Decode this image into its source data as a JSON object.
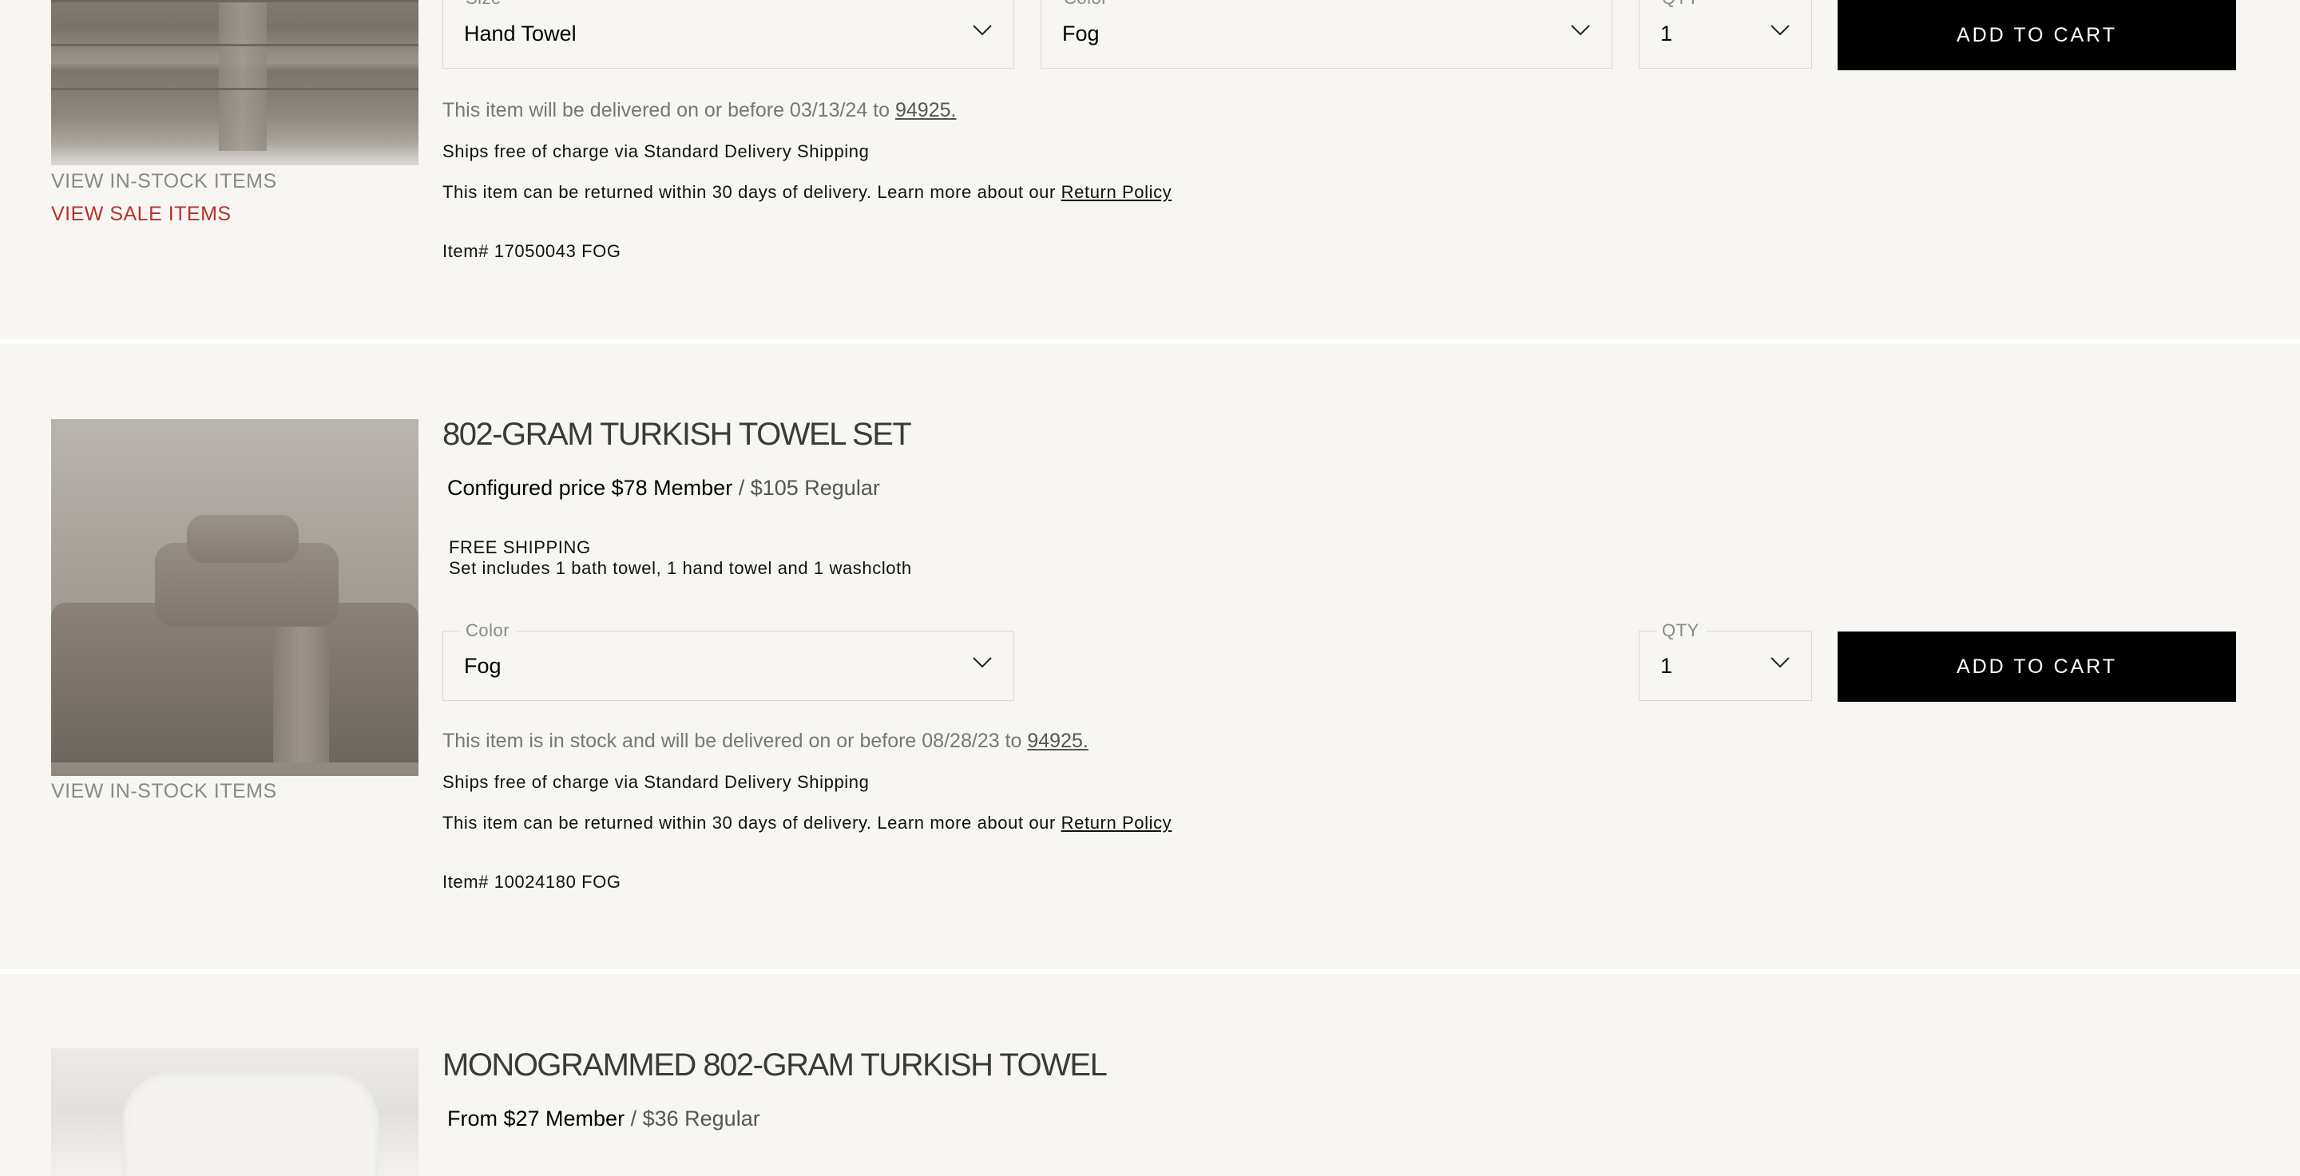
{
  "products": [
    {
      "fields": {
        "size": {
          "label": "Size",
          "value": "Hand Towel"
        },
        "color": {
          "label": "Color",
          "value": "Fog"
        },
        "qty": {
          "label": "QTY",
          "value": "1"
        }
      },
      "add_to_cart": "ADD TO CART",
      "delivery_text": "This item will be delivered on or before 03/13/24 to",
      "zip": "94925.",
      "shipping": "Ships free of charge via Standard Delivery Shipping",
      "returns_text": "This item can be returned within 30 days of delivery. Learn more about our",
      "return_policy": "Return Policy",
      "item_number": "Item# 17050043 FOG",
      "links": {
        "in_stock": "VIEW IN-STOCK ITEMS",
        "sale": "VIEW SALE ITEMS"
      }
    },
    {
      "title": "802-GRAM TURKISH TOWEL SET",
      "price_member": "Configured price $78 Member",
      "price_regular": "/ $105 Regular",
      "free_shipping": "FREE SHIPPING",
      "set_includes": "Set includes 1 bath towel, 1 hand towel and 1 washcloth",
      "fields": {
        "color": {
          "label": "Color",
          "value": "Fog"
        },
        "qty": {
          "label": "QTY",
          "value": "1"
        }
      },
      "add_to_cart": "ADD TO CART",
      "delivery_text": "This item is in stock and will be delivered on or before 08/28/23 to",
      "zip": "94925.",
      "shipping": "Ships free of charge via Standard Delivery Shipping",
      "returns_text": "This item can be returned within 30 days of delivery. Learn more about our",
      "return_policy": "Return Policy",
      "item_number": "Item# 10024180 FOG",
      "links": {
        "in_stock": "VIEW IN-STOCK ITEMS"
      }
    },
    {
      "title": "MONOGRAMMED 802-GRAM TURKISH TOWEL",
      "price_member": "From $27 Member",
      "price_regular": "/ $36 Regular"
    }
  ],
  "colors": {
    "background": "#f7f6f2",
    "sale_red": "#b8322e",
    "button": "#000000"
  }
}
